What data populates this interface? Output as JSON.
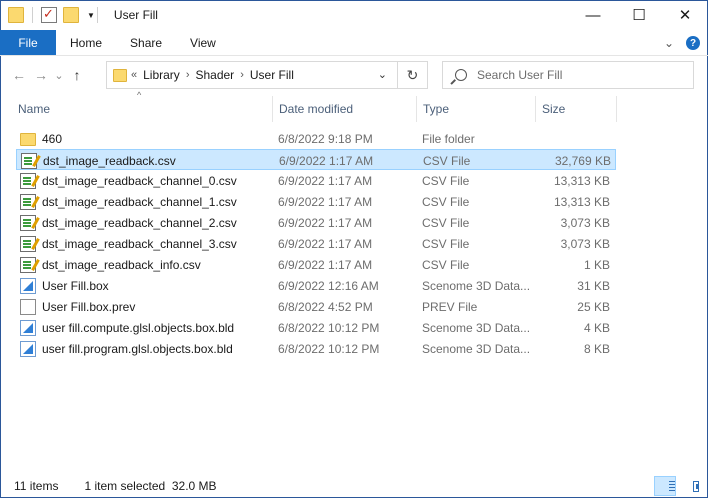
{
  "window": {
    "title": "User Fill",
    "minimize_glyph": "—",
    "maximize_glyph": "☐",
    "close_glyph": "✕"
  },
  "ribbon": {
    "tabs": [
      "File",
      "Home",
      "Share",
      "View"
    ],
    "help_glyph": "?",
    "expand_glyph": "⌄"
  },
  "nav": {
    "back_glyph": "←",
    "forward_glyph": "→",
    "recent_glyph": "⌄",
    "up_glyph": "↑",
    "overflow": "«",
    "path": [
      "Library",
      "Shader",
      "User Fill"
    ],
    "separator": "›",
    "dropdown_glyph": "⌄",
    "refresh_glyph": "↻"
  },
  "search": {
    "placeholder": "Search User Fill",
    "value": ""
  },
  "columns": {
    "name": "Name",
    "date": "Date modified",
    "type": "Type",
    "size": "Size",
    "sort_glyph": "^"
  },
  "files": [
    {
      "name": "460",
      "date": "6/8/2022 9:18 PM",
      "type": "File folder",
      "size": "",
      "icon": "folder-icon"
    },
    {
      "name": "dst_image_readback.csv",
      "date": "6/9/2022 1:17 AM",
      "type": "CSV File",
      "size": "32,769 KB",
      "icon": "csv-file-icon"
    },
    {
      "name": "dst_image_readback_channel_0.csv",
      "date": "6/9/2022 1:17 AM",
      "type": "CSV File",
      "size": "13,313 KB",
      "icon": "csv-file-icon"
    },
    {
      "name": "dst_image_readback_channel_1.csv",
      "date": "6/9/2022 1:17 AM",
      "type": "CSV File",
      "size": "13,313 KB",
      "icon": "csv-file-icon"
    },
    {
      "name": "dst_image_readback_channel_2.csv",
      "date": "6/9/2022 1:17 AM",
      "type": "CSV File",
      "size": "3,073 KB",
      "icon": "csv-file-icon"
    },
    {
      "name": "dst_image_readback_channel_3.csv",
      "date": "6/9/2022 1:17 AM",
      "type": "CSV File",
      "size": "3,073 KB",
      "icon": "csv-file-icon"
    },
    {
      "name": "dst_image_readback_info.csv",
      "date": "6/9/2022 1:17 AM",
      "type": "CSV File",
      "size": "1 KB",
      "icon": "csv-file-icon"
    },
    {
      "name": "User Fill.box",
      "date": "6/9/2022 12:16 AM",
      "type": "Scenome 3D Data...",
      "size": "31 KB",
      "icon": "box-file-icon"
    },
    {
      "name": "User Fill.box.prev",
      "date": "6/8/2022 4:52 PM",
      "type": "PREV File",
      "size": "25 KB",
      "icon": "blank-file-icon"
    },
    {
      "name": "user fill.compute.glsl.objects.box.bld",
      "date": "6/8/2022 10:12 PM",
      "type": "Scenome 3D Data...",
      "size": "4 KB",
      "icon": "box-file-icon"
    },
    {
      "name": "user fill.program.glsl.objects.box.bld",
      "date": "6/8/2022 10:12 PM",
      "type": "Scenome 3D Data...",
      "size": "8 KB",
      "icon": "box-file-icon"
    }
  ],
  "selected_index": 1,
  "status": {
    "item_count": "11 items",
    "selection": "1 item selected  32.0 MB"
  },
  "colors": {
    "accent": "#1a6ec4",
    "selection_bg": "#cce8ff",
    "selection_border": "#99d1ff"
  }
}
